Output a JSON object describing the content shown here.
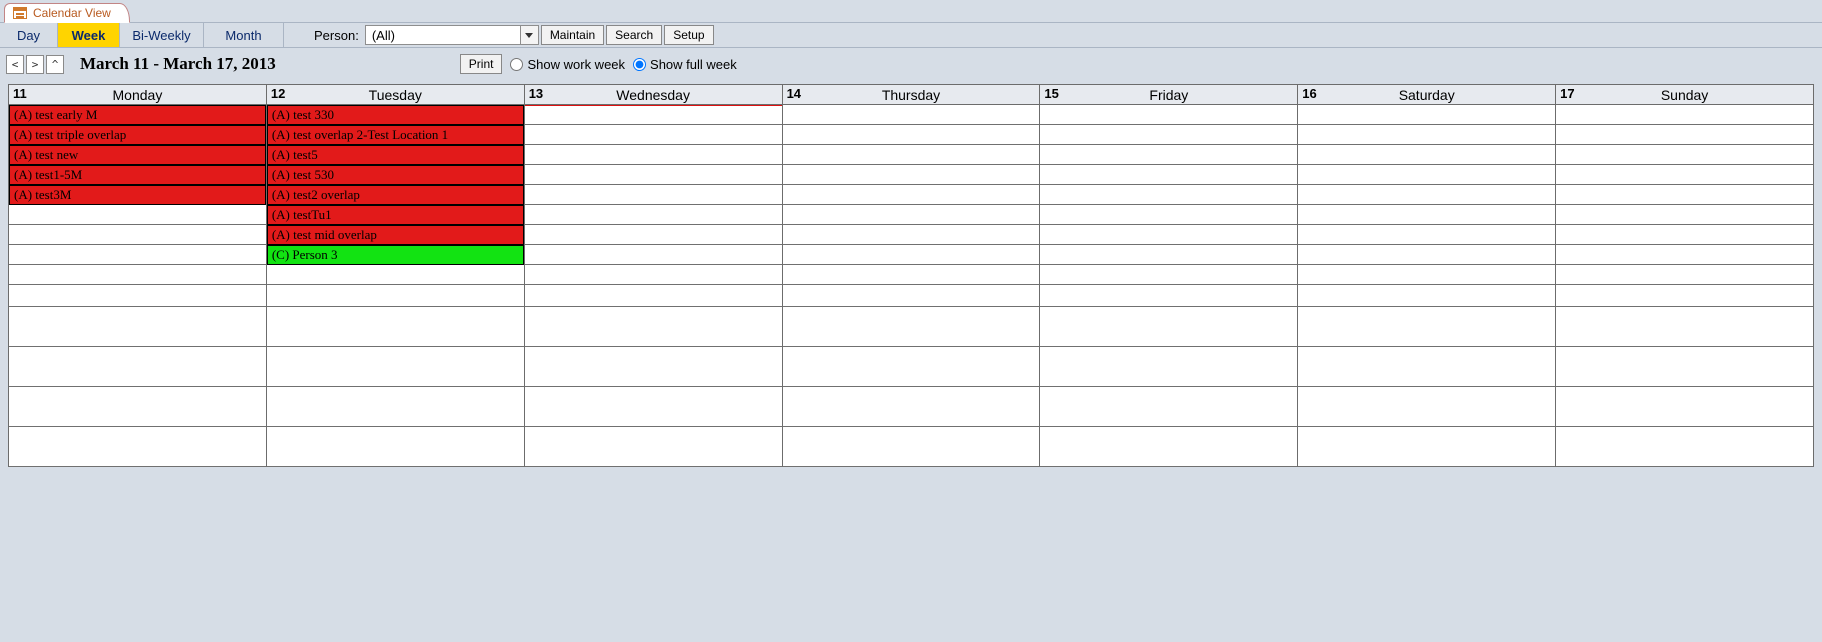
{
  "tab": {
    "title": "Calendar View"
  },
  "views": {
    "day": "Day",
    "week": "Week",
    "biweekly": "Bi-Weekly",
    "month": "Month",
    "active": "Week"
  },
  "person": {
    "label": "Person:",
    "value": "(All)"
  },
  "buttons": {
    "maintain": "Maintain",
    "search": "Search",
    "setup": "Setup",
    "print": "Print"
  },
  "nav": {
    "prev": "<",
    "next": ">",
    "up": "^"
  },
  "date_range": "March 11 - March 17, 2013",
  "week_radio": {
    "work": "Show work week",
    "full": "Show full week",
    "selected": "full"
  },
  "days": [
    {
      "num": "11",
      "name": "Monday"
    },
    {
      "num": "12",
      "name": "Tuesday"
    },
    {
      "num": "13",
      "name": "Wednesday"
    },
    {
      "num": "14",
      "name": "Thursday"
    },
    {
      "num": "15",
      "name": "Friday"
    },
    {
      "num": "16",
      "name": "Saturday"
    },
    {
      "num": "17",
      "name": "Sunday"
    }
  ],
  "rows_per_day": 14,
  "today_index": 2,
  "events": {
    "0": [
      {
        "text": "(A) test early M",
        "color": "red"
      },
      {
        "text": "(A) test triple overlap",
        "color": "red"
      },
      {
        "text": "(A) test new",
        "color": "red"
      },
      {
        "text": "(A) test1-5M",
        "color": "red"
      },
      {
        "text": "(A) test3M",
        "color": "red"
      }
    ],
    "1": [
      {
        "text": "(A) test 330",
        "color": "red"
      },
      {
        "text": "(A) test overlap 2-Test Location 1",
        "color": "red"
      },
      {
        "text": "(A) test5",
        "color": "red"
      },
      {
        "text": "(A) test 530",
        "color": "red"
      },
      {
        "text": "(A) test2 overlap",
        "color": "red"
      },
      {
        "text": "(A) testTu1",
        "color": "red"
      },
      {
        "text": "(A) test mid overlap",
        "color": "red"
      },
      {
        "text": "(C) Person 3",
        "color": "green"
      }
    ],
    "2": [],
    "3": [],
    "4": [],
    "5": [],
    "6": []
  }
}
